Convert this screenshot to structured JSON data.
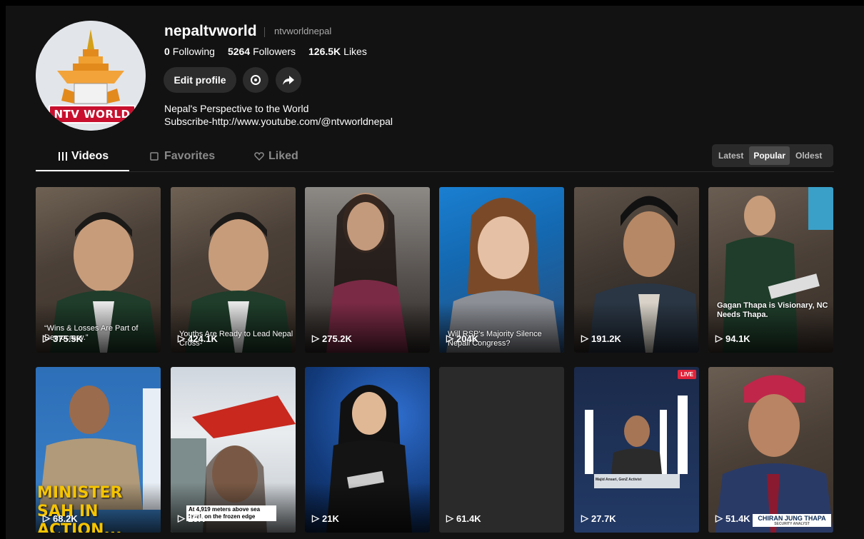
{
  "profile": {
    "avatar_text": "NTV WORLD",
    "username": "nepaltvworld",
    "handle": "ntvworldnepal",
    "following_count": "0",
    "following_label": "Following",
    "followers_count": "5264",
    "followers_label": "Followers",
    "likes_count": "126.5K",
    "likes_label": "Likes",
    "edit_label": "Edit profile",
    "bio_line1": "Nepal's Perspective to the World",
    "bio_line2": "Subscribe-http://www.youtube.com/@ntvworldnepal"
  },
  "tabs": [
    {
      "label": "Videos",
      "icon": "grid-icon"
    },
    {
      "label": "Favorites",
      "icon": "bookmark-icon"
    },
    {
      "label": "Liked",
      "icon": "heart-icon"
    }
  ],
  "sort": [
    "Latest",
    "Popular",
    "Oldest"
  ],
  "colors": {
    "background": "#121212",
    "active_tab": "#ffffff",
    "inactive_tab": "#8a8a8a",
    "live_badge": "#e0243b"
  },
  "videos": [
    {
      "views": "375.5K",
      "caption": "“Wins & Losses Are Part of Democracy.”"
    },
    {
      "views": "424.1K",
      "caption": "Youths Are Ready to Lead Nepal Cross-"
    },
    {
      "views": "275.2K"
    },
    {
      "views": "204K",
      "caption": "Will RSP's Majority Silence Nepali Congress?"
    },
    {
      "views": "191.2K"
    },
    {
      "views": "94.1K",
      "caption": "Gagan Thapa is Visionary, NC Needs Thapa."
    },
    {
      "views": "68.2K",
      "caption": "MINISTER SAH IN ACTION..."
    },
    {
      "views": "15K",
      "caption": "At 4,919 meters above sea level, on the frozen edge"
    },
    {
      "views": "21K"
    },
    {
      "views": "61.4K"
    },
    {
      "views": "27.7K",
      "caption": "Majid Ansari, GenZ Activist",
      "badge": "LIVE"
    },
    {
      "views": "51.4K",
      "caption": "CHIRAN JUNG THAPA",
      "subcaption": "SECURITY ANALYST"
    }
  ]
}
